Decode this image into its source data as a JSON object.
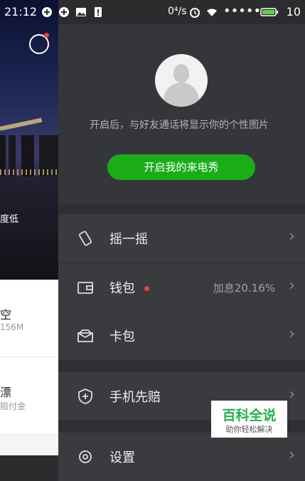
{
  "status_bar": {
    "time": "21:12",
    "network_speed": "0⁴/s",
    "signal": "•••••",
    "battery_level": "10"
  },
  "left_page": {
    "partial_text_1": "度低",
    "items": [
      {
        "title": "空",
        "sub": "156M"
      },
      {
        "title": "漂",
        "sub": "赔付金"
      }
    ]
  },
  "drawer": {
    "profile": {
      "description": "开启后，与好友通话将显示你的个性图片",
      "cta_label": "开启我的来电秀"
    },
    "menu": [
      {
        "label": "摇一摇",
        "icon": "shake-icon"
      },
      {
        "label": "钱包",
        "icon": "wallet-icon",
        "extra": "加息20.16%",
        "badge": true
      },
      {
        "label": "卡包",
        "icon": "card-package-icon"
      },
      {
        "label": "手机先赔",
        "icon": "shield-icon"
      },
      {
        "label": "设置",
        "icon": "gear-icon"
      }
    ],
    "chevron": "›"
  },
  "watermark": {
    "title": "百科全说",
    "subtitle": "助你轻松解决"
  },
  "colors": {
    "accent": "#1aad19",
    "drawer_bg": "#2e2f31",
    "badge": "#e64340"
  }
}
